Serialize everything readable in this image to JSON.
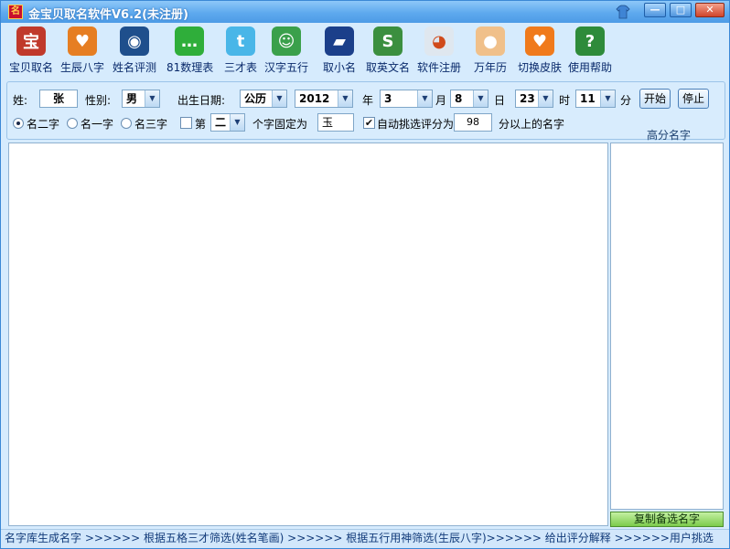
{
  "window": {
    "title": "金宝贝取名软件V6.2(未注册)",
    "app_icon_glyph": "名"
  },
  "controls": {
    "minimize": "—",
    "maximize": "□",
    "close": "✕"
  },
  "toolbar": [
    {
      "label": "宝贝取名",
      "icon": "baby-icon",
      "color": "#c0392b",
      "glyph": "宝"
    },
    {
      "label": "生辰八字",
      "icon": "magnifier-heart-icon",
      "color": "#e67e22",
      "glyph": "♥"
    },
    {
      "label": "姓名评测",
      "icon": "myspace-icon",
      "color": "#1f4f8c",
      "glyph": "◉"
    },
    {
      "label": "81数理表",
      "icon": "chat-bubble-icon",
      "color": "#2fae3a",
      "glyph": "…"
    },
    {
      "label": "三才表",
      "icon": "twitter-bird-icon",
      "color": "#49b6e8",
      "glyph": "t"
    },
    {
      "label": "汉字五行",
      "icon": "users-icon",
      "color": "#3aa04b",
      "glyph": "☺"
    },
    {
      "label": "取小名",
      "icon": "car-icon",
      "color": "#1b3f8a",
      "glyph": "▰"
    },
    {
      "label": "取英文名",
      "icon": "stumbleupon-icon",
      "color": "#3b8f3f",
      "glyph": "S"
    },
    {
      "label": "软件注册",
      "icon": "reddit-icon",
      "color": "#dfe7ef",
      "glyph": "◕"
    },
    {
      "label": "万年历",
      "icon": "calendar-dots-icon",
      "color": "#f0c08a",
      "glyph": "●"
    },
    {
      "label": "切换皮肤",
      "icon": "heart-icon",
      "color": "#f07a1b",
      "glyph": "♥"
    },
    {
      "label": "使用帮助",
      "icon": "help-book-icon",
      "color": "#2e8b3a",
      "glyph": "?"
    }
  ],
  "form": {
    "surname_label": "姓:",
    "surname_value": "张",
    "gender_label": "性别:",
    "gender_value": "男",
    "birth_label": "出生日期:",
    "calendar_value": "公历",
    "year_value": "2012",
    "year_label": "年",
    "month_value": "3",
    "month_label": "月",
    "day_value": "8",
    "day_label": "日",
    "hour_value": "23",
    "hour_label": "时",
    "minute_value": "11",
    "minute_label": "分",
    "start_button": "开始",
    "stop_button": "停止",
    "radio_two": "名二字",
    "radio_one": "名一字",
    "radio_three": "名三字",
    "fixed_di": "第",
    "fixed_position_value": "二",
    "fixed_suffix": "个字固定为",
    "fixed_char_value": "玉",
    "auto_pick_label": "自动挑选评分为",
    "score_value": "98",
    "score_suffix": "分以上的名字"
  },
  "side": {
    "title": "高分名字",
    "copy_button": "复制备选名字"
  },
  "status": {
    "text": "名字库生成名字 >>>>>> 根据五格三才筛选(姓名笔画) >>>>>> 根据五行用神筛选(生辰八字)>>>>>> 给出评分解释 >>>>>>用户挑选"
  }
}
